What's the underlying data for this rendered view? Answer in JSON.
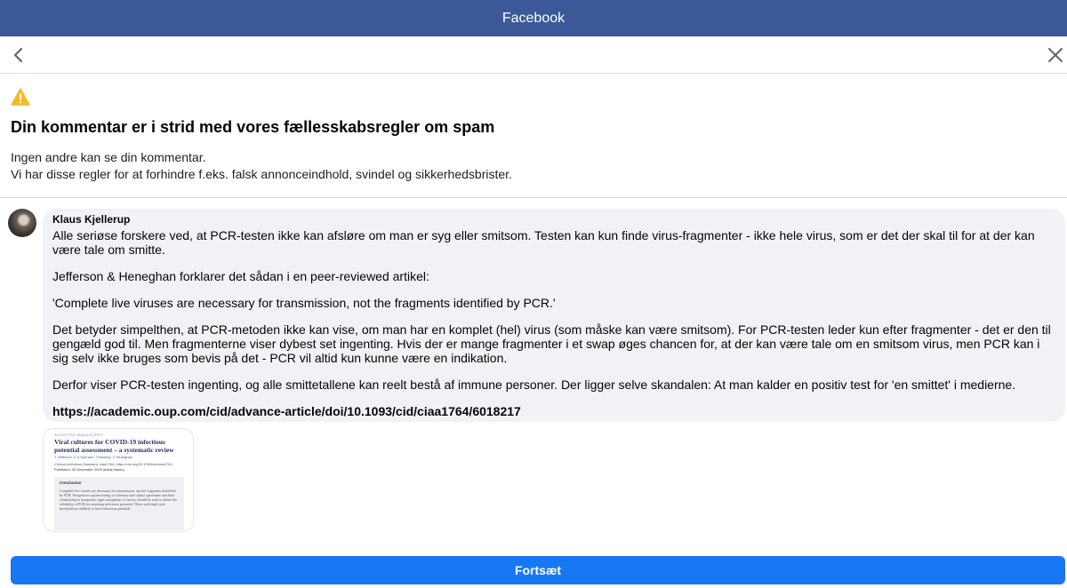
{
  "header": {
    "title": "Facebook"
  },
  "nav": {
    "back_icon": "chevron-left-icon",
    "close_icon": "close-icon"
  },
  "notice": {
    "icon": "warning-icon",
    "icon_color": "#f7b928",
    "heading": "Din kommentar er i strid med vores fællesskabsregler om spam",
    "line1": "Ingen andre kan se din kommentar.",
    "line2": "Vi har disse regler for at forhindre f.eks. falsk annonceindhold, svindel og sikkerhedsbrister."
  },
  "comment": {
    "author": "Klaus Kjellerup",
    "paragraphs": [
      "Alle seriøse forskere ved, at PCR-testen ikke kan afsløre om man er syg eller smitsom. Testen kan kun finde virus-fragmenter - ikke hele virus, som er det der skal til for at der kan være tale om smitte.",
      "Jefferson & Heneghan forklarer det sådan i en peer-reviewed artikel:",
      "'Complete live viruses are necessary for transmission, not the fragments identified by PCR.'",
      "Det betyder simpelthen, at PCR-metoden ikke kan vise, om man har en komplet (hel) virus (som måske kan være smitsom). For PCR-testen leder kun efter fragmenter - det er den til gengæld god til. Men fragmenterne viser dybest set ingenting. Hvis der er mange fragmenter i et swap øges chancen for, at der kan være tale om en smitsom virus, men PCR kan i sig selv ikke bruges som bevis på det - PCR vil altid kun kunne være en indikation.",
      "Derfor viser PCR-testen ingenting, og alle smittetallene kan reelt bestå af immune personer. Der ligger selve skandalen: At man kalder en positiv test for 'en smittet' i medierne."
    ],
    "link": "https://academic.oup.com/cid/advance-article/doi/10.1093/cid/ciaa1764/6018217"
  },
  "attachment": {
    "label": "ACCEPTED MANUSCRIPT",
    "title": "Viral cultures for COVID-19 infectious potential assessment – a systematic review",
    "authors": "T Jefferson, E A Spencer, J Brassey, C Heneghan",
    "journal": "Clinical Infectious Diseases, ciaa1764, https://doi.org/10.1093/cid/ciaa1764",
    "published": "Published: 03 December 2020    Article history",
    "box_heading": "Conclusion",
    "box_text": "Complete live viruses are necessary for transmission, not the fragments identified by PCR. Prospective routine testing of reference and culture specimens and their relationship to symptoms, signs and patient co-factors should be used to define the reliability of PCR for assessing infectious potential. Those with high cycle threshold are unlikely to have infectious potential."
  },
  "footer": {
    "continue_label": "Fortsæt"
  },
  "colors": {
    "header_bg": "#3b5998",
    "button_bg": "#1877f2",
    "bubble_bg": "#f0f2f5"
  }
}
